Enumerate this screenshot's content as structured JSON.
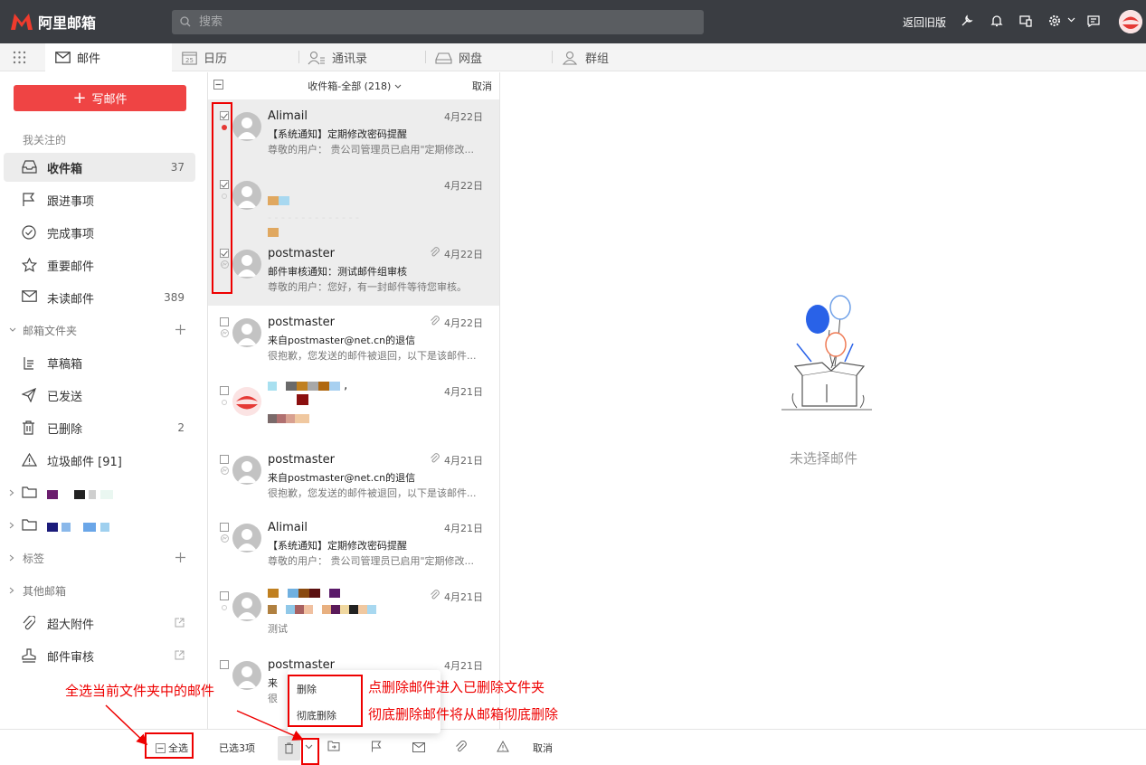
{
  "brand": {
    "name": "阿里邮箱"
  },
  "search": {
    "placeholder": "搜索"
  },
  "top_actions": {
    "return_old": "返回旧版"
  },
  "nav_tabs": [
    {
      "label": "邮件",
      "icon": "mail-icon"
    },
    {
      "label": "日历",
      "icon": "calendar-icon",
      "icon_text": "25"
    },
    {
      "label": "通讯录",
      "icon": "contacts-icon"
    },
    {
      "label": "网盘",
      "icon": "drive-icon"
    },
    {
      "label": "群组",
      "icon": "group-icon"
    }
  ],
  "sidebar": {
    "compose": "写邮件",
    "section_followed": "我关注的",
    "items": [
      {
        "label": "收件箱",
        "count": "37",
        "icon": "inbox-icon"
      },
      {
        "label": "跟进事项",
        "count": "",
        "icon": "flag-icon"
      },
      {
        "label": "完成事项",
        "count": "",
        "icon": "check-circle-icon"
      },
      {
        "label": "重要邮件",
        "count": "",
        "icon": "star-icon"
      },
      {
        "label": "未读邮件",
        "count": "389",
        "icon": "envelope-icon"
      }
    ],
    "folders_header": "邮箱文件夹",
    "folders": [
      {
        "label": "草稿箱",
        "count": "",
        "icon": "draft-icon"
      },
      {
        "label": "已发送",
        "count": "",
        "icon": "send-icon"
      },
      {
        "label": "已删除",
        "count": "2",
        "icon": "trash-icon"
      },
      {
        "label": "垃圾邮件 [91]",
        "count": "",
        "icon": "warning-icon"
      }
    ],
    "tags_header": "标签",
    "other_header": "其他邮箱",
    "extras": [
      {
        "label": "超大附件",
        "icon": "paperclip-icon"
      },
      {
        "label": "邮件审核",
        "icon": "stamp-icon"
      }
    ]
  },
  "list": {
    "header_title": "收件箱-全部 (218)",
    "cancel": "取消",
    "mails": [
      {
        "sender": "Alimail",
        "date": "4月22日",
        "subject": "【系统通知】定期修改密码提醒",
        "preview": "尊敬的用户： 贵公司管理员已启用\"定期修改...",
        "checked": true,
        "selected": true,
        "attach": false
      },
      {
        "sender": "",
        "date": "4月22日",
        "subject": "",
        "preview": "",
        "checked": true,
        "selected": true,
        "attach": false
      },
      {
        "sender": "postmaster",
        "date": "4月22日",
        "subject": "邮件审核通知：测试邮件组审核",
        "preview": "尊敬的用户：您好，有一封邮件等待您审核。",
        "checked": true,
        "selected": true,
        "attach": true
      },
      {
        "sender": "postmaster",
        "date": "4月22日",
        "subject": "来自postmaster@net.cn的退信",
        "preview": "很抱歉，您发送的邮件被退回，以下是该邮件...",
        "checked": false,
        "selected": false,
        "attach": true
      },
      {
        "sender": "",
        "date": "4月21日",
        "subject": "",
        "preview": "",
        "checked": false,
        "selected": false,
        "attach": false
      },
      {
        "sender": "postmaster",
        "date": "4月21日",
        "subject": "来自postmaster@net.cn的退信",
        "preview": "很抱歉，您发送的邮件被退回，以下是该邮件...",
        "checked": false,
        "selected": false,
        "attach": true
      },
      {
        "sender": "Alimail",
        "date": "4月21日",
        "subject": "【系统通知】定期修改密码提醒",
        "preview": "尊敬的用户： 贵公司管理员已启用\"定期修改...",
        "checked": false,
        "selected": false,
        "attach": false
      },
      {
        "sender": "",
        "date": "4月21日",
        "subject": "",
        "preview": "测试",
        "checked": false,
        "selected": false,
        "attach": true
      },
      {
        "sender": "postmaster",
        "date": "4月21日",
        "subject": "来",
        "preview": "很",
        "checked": false,
        "selected": false,
        "attach": false
      }
    ]
  },
  "detail": {
    "empty_text": "未选择邮件"
  },
  "bottom": {
    "select_all": "全选",
    "selected_count": "已选3项",
    "cancel": "取消"
  },
  "dropdown": {
    "delete": "删除",
    "delete_forever": "彻底删除"
  },
  "annotations": {
    "select_all_note": "全选当前文件夹中的邮件",
    "delete_note": "点删除邮件进入已删除文件夹",
    "delete_forever_note": "彻底删除邮件将从邮箱彻底删除"
  },
  "colors": {
    "accent": "#ef4444",
    "topbar": "#3a3d42",
    "annotation": "#e00000"
  }
}
